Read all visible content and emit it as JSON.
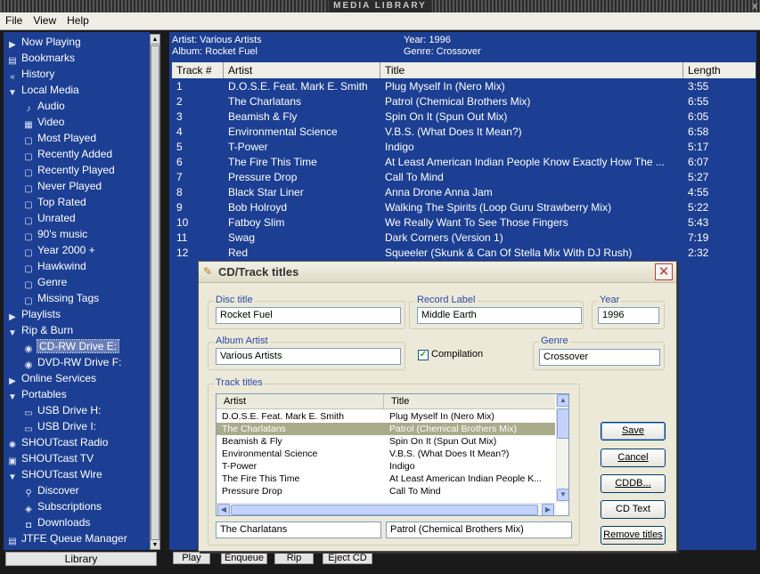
{
  "window": {
    "title": "MEDIA LIBRARY",
    "close": "x"
  },
  "menu": [
    "File",
    "View",
    "Help"
  ],
  "nav": [
    {
      "label": "Now Playing",
      "icon": "now-playing-icon",
      "glyph": "▶",
      "level": 0
    },
    {
      "label": "Bookmarks",
      "icon": "bookmarks-icon",
      "glyph": "▤",
      "level": 0
    },
    {
      "label": "History",
      "icon": "history-icon",
      "glyph": "«",
      "level": 0
    },
    {
      "label": "Local Media",
      "icon": "expanded-triangle-icon",
      "glyph": "▼",
      "level": 0
    },
    {
      "label": "Audio",
      "icon": "audio-icon",
      "glyph": "♪",
      "level": 1
    },
    {
      "label": "Video",
      "icon": "video-icon",
      "glyph": "▦",
      "level": 1
    },
    {
      "label": "Most Played",
      "icon": "smart-view-icon",
      "glyph": "▢",
      "level": 1
    },
    {
      "label": "Recently Added",
      "icon": "smart-view-icon",
      "glyph": "▢",
      "level": 1
    },
    {
      "label": "Recently Played",
      "icon": "smart-view-icon",
      "glyph": "▢",
      "level": 1
    },
    {
      "label": "Never Played",
      "icon": "smart-view-icon",
      "glyph": "▢",
      "level": 1
    },
    {
      "label": "Top Rated",
      "icon": "smart-view-icon",
      "glyph": "▢",
      "level": 1
    },
    {
      "label": "Unrated",
      "icon": "smart-view-icon",
      "glyph": "▢",
      "level": 1
    },
    {
      "label": "90's music",
      "icon": "smart-view-icon",
      "glyph": "▢",
      "level": 1
    },
    {
      "label": "Year 2000 +",
      "icon": "smart-view-icon",
      "glyph": "▢",
      "level": 1
    },
    {
      "label": "Hawkwind",
      "icon": "smart-view-icon",
      "glyph": "▢",
      "level": 1
    },
    {
      "label": "Genre",
      "icon": "smart-view-icon",
      "glyph": "▢",
      "level": 1
    },
    {
      "label": "Missing Tags",
      "icon": "smart-view-icon",
      "glyph": "▢",
      "level": 1
    },
    {
      "label": "Playlists",
      "icon": "collapsed-triangle-icon",
      "glyph": "▶",
      "level": 0
    },
    {
      "label": "Rip & Burn",
      "icon": "expanded-triangle-icon",
      "glyph": "▼",
      "level": 0
    },
    {
      "label": "CD-RW  Drive  E:",
      "icon": "cd-icon",
      "glyph": "◉",
      "level": 1,
      "selected": true
    },
    {
      "label": "DVD-RW  Drive  F:",
      "icon": "cd-icon",
      "glyph": "◉",
      "level": 1
    },
    {
      "label": "Online Services",
      "icon": "collapsed-triangle-icon",
      "glyph": "▶",
      "level": 0
    },
    {
      "label": "Portables",
      "icon": "expanded-triangle-icon",
      "glyph": "▼",
      "level": 0
    },
    {
      "label": "USB Drive H:",
      "icon": "usb-drive-icon",
      "glyph": "▭",
      "level": 1
    },
    {
      "label": "USB Drive I:",
      "icon": "usb-drive-icon",
      "glyph": "▭",
      "level": 1
    },
    {
      "label": "SHOUTcast Radio",
      "icon": "radio-icon",
      "glyph": "✺",
      "level": 0
    },
    {
      "label": "SHOUTcast TV",
      "icon": "tv-icon",
      "glyph": "▣",
      "level": 0
    },
    {
      "label": "SHOUTcast Wire",
      "icon": "expanded-triangle-icon",
      "glyph": "▼",
      "level": 0
    },
    {
      "label": "Discover",
      "icon": "discover-icon",
      "glyph": "⚲",
      "level": 1
    },
    {
      "label": "Subscriptions",
      "icon": "subscriptions-icon",
      "glyph": "◈",
      "level": 1
    },
    {
      "label": "Downloads",
      "icon": "downloads-icon",
      "glyph": "◘",
      "level": 1
    },
    {
      "label": "JTFE Queue Manager",
      "icon": "queue-icon",
      "glyph": "▤",
      "level": 0
    }
  ],
  "library_button": "Library",
  "album_info": {
    "artist": "Artist: Various Artists",
    "album": "Album: Rocket Fuel",
    "year": "Year: 1996",
    "genre": "Genre: Crossover"
  },
  "track_columns": [
    "Track #",
    "Artist",
    "Title",
    "Length"
  ],
  "tracks": [
    {
      "n": "1",
      "artist": "D.O.S.E. Feat. Mark E. Smith",
      "title": "Plug Myself In (Nero Mix)",
      "length": "3:55"
    },
    {
      "n": "2",
      "artist": "The Charlatans",
      "title": "Patrol (Chemical Brothers Mix)",
      "length": "6:55"
    },
    {
      "n": "3",
      "artist": "Beamish & Fly",
      "title": "Spin On It (Spun Out Mix)",
      "length": "6:05"
    },
    {
      "n": "4",
      "artist": "Environmental Science",
      "title": "V.B.S. (What Does It Mean?)",
      "length": "6:58"
    },
    {
      "n": "5",
      "artist": "T-Power",
      "title": "Indigo",
      "length": "5:17"
    },
    {
      "n": "6",
      "artist": "The Fire This Time",
      "title": "At Least American Indian People Know Exactly How The ...",
      "length": "6:07"
    },
    {
      "n": "7",
      "artist": "Pressure Drop",
      "title": "Call To Mind",
      "length": "5:27"
    },
    {
      "n": "8",
      "artist": "Black Star Liner",
      "title": "Anna Drone Anna Jam",
      "length": "4:55"
    },
    {
      "n": "9",
      "artist": "Bob Holroyd",
      "title": "Walking The Spirits (Loop Guru Strawberry Mix)",
      "length": "5:22"
    },
    {
      "n": "10",
      "artist": "Fatboy Slim",
      "title": "We Really Want To See Those Fingers",
      "length": "5:43"
    },
    {
      "n": "11",
      "artist": "Swag",
      "title": "Dark Corners (Version 1)",
      "length": "7:19"
    },
    {
      "n": "12",
      "artist": "Red",
      "title": "Squeeler (Skunk & Can Of Stella Mix With DJ Rush)",
      "length": "2:32"
    }
  ],
  "bottom_buttons": [
    "Play",
    "Enqueue",
    "Rip",
    "Eject CD"
  ],
  "dialog": {
    "title": "CD/Track titles",
    "disc_title_label": "Disc title",
    "disc_title": "Rocket Fuel",
    "record_label_label": "Record Label",
    "record_label": "Middle Earth",
    "year_label": "Year",
    "year": "1996",
    "album_artist_label": "Album Artist",
    "album_artist": "Various Artists",
    "compilation_label": "Compilation",
    "compilation_checked": true,
    "genre_label": "Genre",
    "genre": "Crossover",
    "track_titles_label": "Track titles",
    "list_columns": [
      "Artist",
      "Title"
    ],
    "list_rows": [
      {
        "artist": "D.O.S.E. Feat. Mark E. Smith",
        "title": "Plug Myself In (Nero Mix)"
      },
      {
        "artist": "The Charlatans",
        "title": "Patrol (Chemical Brothers Mix)",
        "selected": true
      },
      {
        "artist": "Beamish & Fly",
        "title": "Spin On It (Spun Out Mix)"
      },
      {
        "artist": "Environmental Science",
        "title": "V.B.S. (What Does It Mean?)"
      },
      {
        "artist": "T-Power",
        "title": "Indigo"
      },
      {
        "artist": "The Fire This Time",
        "title": "At Least American Indian People K..."
      },
      {
        "artist": "Pressure Drop",
        "title": "Call To Mind"
      }
    ],
    "edit_artist": "The Charlatans",
    "edit_title": "Patrol (Chemical Brothers Mix)",
    "buttons": {
      "save": "Save",
      "cancel": "Cancel",
      "cddb": "CDDB...",
      "cd_text": "CD Text",
      "remove_titles": "Remove titles"
    },
    "close": "✕"
  },
  "colors": {
    "pane_bg": "#1c3f93",
    "selection": "#a9ac8a",
    "dialog_bg": "#ece9d8",
    "group_label": "#2a4aa8"
  }
}
